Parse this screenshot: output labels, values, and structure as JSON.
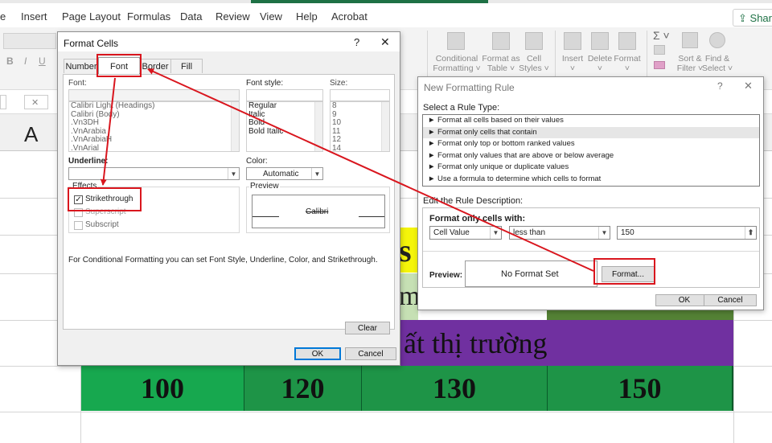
{
  "ribbon": {
    "menu": [
      "e",
      "Insert",
      "Page Layout",
      "Formulas",
      "Data",
      "Review",
      "View",
      "Help",
      "Acrobat"
    ],
    "share_label": "Share",
    "font_buttons": [
      "B",
      "I",
      "U"
    ],
    "groups": [
      {
        "line1": "Conditional",
        "line2": "Formatting ˅"
      },
      {
        "line1": "Format as",
        "line2": "Table ˅"
      },
      {
        "line1": "Cell",
        "line2": "Styles ˅"
      },
      {
        "line1": "Insert",
        "line2": "˅"
      },
      {
        "line1": "Delete",
        "line2": "˅"
      },
      {
        "line1": "Format",
        "line2": "˅"
      },
      {
        "line1": "Sort &",
        "line2": "Filter ˅"
      },
      {
        "line1": "Find &",
        "line2": "Select ˅"
      }
    ],
    "sum_symbol": "Σ ˅",
    "cancel_glyph": "✕"
  },
  "sheet": {
    "column_letter": "A",
    "partial_s": "s",
    "partial_m": "m",
    "market_text": "ất thị trường",
    "numbers": [
      "100",
      "120",
      "130",
      "150"
    ],
    "colors": {
      "yellow": "#f5f50a",
      "light_green": "#c6e0b4",
      "purple": "#7030a0",
      "green": "#17a84f",
      "dark_green": "#1e9447",
      "olive": "#548235"
    }
  },
  "format_cells": {
    "title": "Format Cells",
    "help_glyph": "?",
    "close_glyph": "✕",
    "tabs": [
      "Number",
      "Font",
      "Border",
      "Fill"
    ],
    "font_label": "Font:",
    "font_list": [
      "Calibri Light (Headings)",
      "Calibri (Body)",
      ".Vn3DH",
      ".VnArabia",
      ".VnArabiaH",
      ".VnArial"
    ],
    "style_label": "Font style:",
    "style_list": [
      "Regular",
      "Italic",
      "Bold",
      "Bold Italic"
    ],
    "size_label": "Size:",
    "size_list": [
      "8",
      "9",
      "10",
      "11",
      "12",
      "14"
    ],
    "underline_label": "Underline:",
    "color_label": "Color:",
    "color_value": "Automatic",
    "effects_label": "Effects",
    "strikethrough_label": "Strikethrough",
    "strikethrough_checked": true,
    "superscript_label": "Superscript",
    "subscript_label": "Subscript",
    "preview_label": "Preview",
    "preview_sample": "Calibri",
    "note": "For Conditional Formatting you can set Font Style, Underline, Color, and Strikethrough.",
    "clear_label": "Clear",
    "ok_label": "OK",
    "cancel_label": "Cancel"
  },
  "new_rule": {
    "title": "New Formatting Rule",
    "help_glyph": "?",
    "close_glyph": "✕",
    "select_type_label": "Select a Rule Type:",
    "rule_types": [
      "► Format all cells based on their values",
      "► Format only cells that contain",
      "► Format only top or bottom ranked values",
      "► Format only values that are above or below average",
      "► Format only unique or duplicate values",
      "► Use a formula to determine which cells to format"
    ],
    "edit_label": "Edit the Rule Description:",
    "format_only_label": "Format only cells with:",
    "condition_type": "Cell Value",
    "operator": "less than",
    "value": "150",
    "preview_label": "Preview:",
    "preview_text": "No Format Set",
    "format_button": "Format...",
    "ok_label": "OK",
    "cancel_label": "Cancel"
  },
  "annotation_color": "#d9161e"
}
